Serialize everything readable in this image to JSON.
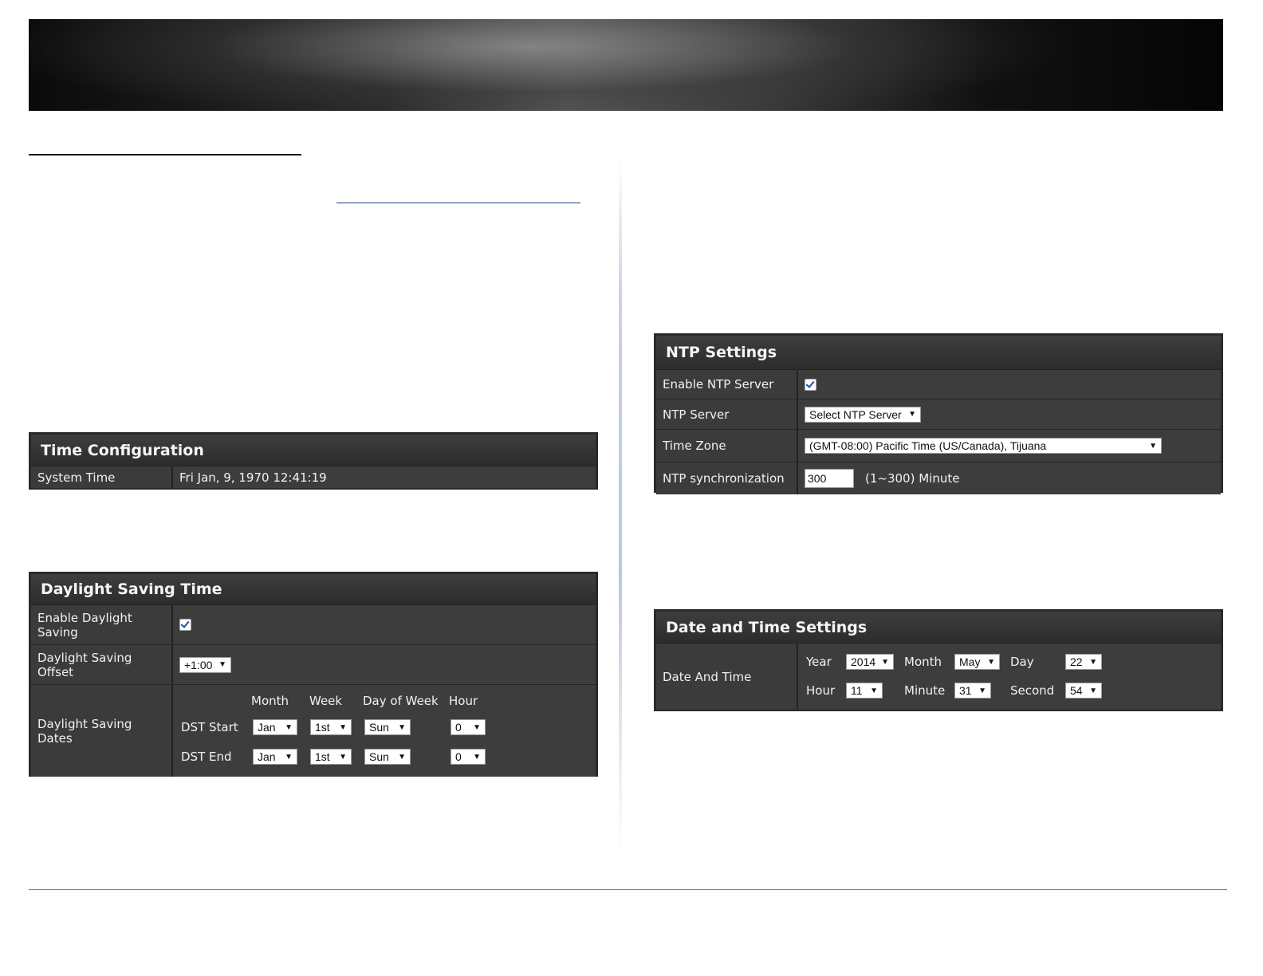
{
  "time_config": {
    "title": "Time Configuration",
    "system_time_label": "System Time",
    "system_time_value": "Fri Jan, 9, 1970 12:41:19"
  },
  "dst": {
    "title": "Daylight Saving Time",
    "enable_label": "Enable Daylight Saving",
    "enable_checked": true,
    "offset_label": "Daylight Saving Offset",
    "offset_value": "+1:00",
    "dates_label": "Daylight Saving Dates",
    "col_month": "Month",
    "col_week": "Week",
    "col_dow": "Day of Week",
    "col_hour": "Hour",
    "start": {
      "label": "DST Start",
      "month": "Jan",
      "week": "1st",
      "dow": "Sun",
      "hour": "0"
    },
    "end": {
      "label": "DST End",
      "month": "Jan",
      "week": "1st",
      "dow": "Sun",
      "hour": "0"
    }
  },
  "ntp": {
    "title": "NTP Settings",
    "enable_label": "Enable NTP Server",
    "enable_checked": true,
    "server_label": "NTP Server",
    "server_value": "Select NTP Server",
    "timezone_label": "Time Zone",
    "timezone_value": "(GMT-08:00) Pacific Time (US/Canada), Tijuana",
    "sync_label": "NTP synchronization",
    "sync_value": "300",
    "sync_suffix": "(1~300) Minute"
  },
  "datetime": {
    "title": "Date and Time Settings",
    "label": "Date And Time",
    "year_label": "Year",
    "year_value": "2014",
    "month_label": "Month",
    "month_value": "May",
    "day_label": "Day",
    "day_value": "22",
    "hour_label": "Hour",
    "hour_value": "11",
    "minute_label": "Minute",
    "minute_value": "31",
    "second_label": "Second",
    "second_value": "54"
  },
  "icons": {
    "checkbox": "checkmark-icon",
    "dropdown": "triangle-down-icon"
  },
  "colors": {
    "panel_bg": "#3a3a3a",
    "footer_rule": "#4a90c8"
  }
}
